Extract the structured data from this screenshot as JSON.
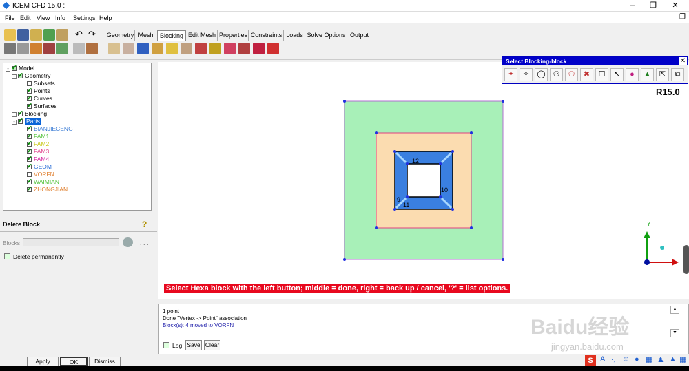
{
  "app": {
    "title": "ICEM CFD 15.0 :",
    "version_badge": "R15.0"
  },
  "menu": [
    "File",
    "Edit",
    "View",
    "Info",
    "Settings",
    "Help"
  ],
  "tabs": [
    {
      "label": "Geometry",
      "active": false
    },
    {
      "label": "Mesh",
      "active": false
    },
    {
      "label": "Blocking",
      "active": true
    },
    {
      "label": "Edit Mesh",
      "active": false
    },
    {
      "label": "Properties",
      "active": false
    },
    {
      "label": "Constraints",
      "active": false
    },
    {
      "label": "Loads",
      "active": false
    },
    {
      "label": "Solve Options",
      "active": false
    },
    {
      "label": "Output",
      "active": false
    }
  ],
  "tree": {
    "model": "Model",
    "geometry": "Geometry",
    "geo_items": [
      "Subsets",
      "Points",
      "Curves",
      "Surfaces"
    ],
    "blocking": "Blocking",
    "parts": "Parts",
    "part_items": [
      {
        "name": "BIANJIECENG",
        "color": "#3a7bd5",
        "checked": true
      },
      {
        "name": "FAM1",
        "color": "#52c23a",
        "checked": true
      },
      {
        "name": "FAM2",
        "color": "#c8c814",
        "checked": true
      },
      {
        "name": "FAM3",
        "color": "#e0408a",
        "checked": true
      },
      {
        "name": "FAM4",
        "color": "#d4209c",
        "checked": true
      },
      {
        "name": "GEOM",
        "color": "#2a6ed6",
        "checked": true
      },
      {
        "name": "VORFN",
        "color": "#e08030",
        "checked": false
      },
      {
        "name": "WAIMIAN",
        "color": "#52c23a",
        "checked": true
      },
      {
        "name": "ZHONGJIAN",
        "color": "#e08030",
        "checked": true
      }
    ]
  },
  "panel": {
    "title": "Delete Block",
    "blocks_label": "Blocks",
    "delete_permanently": "Delete permanently",
    "buttons": [
      "Apply",
      "OK",
      "Dismiss"
    ],
    "dots": ". . ."
  },
  "dialog": {
    "title": "Select Blocking-block"
  },
  "status_message": "Select Hexa block with the left button; middle = done, right = back up / cancel, '?' = list options.",
  "log": {
    "lines": [
      {
        "text": "1 point",
        "color": "#000"
      },
      {
        "text": "Done \"Vertex -> Point\" association",
        "color": "#000"
      },
      {
        "text": "Block(s): 4 moved to VORFN",
        "color": "#1a1aa8"
      }
    ],
    "log_label": "Log",
    "save": "Save",
    "clear": "Clear"
  },
  "viewport": {
    "block_labels": [
      "12",
      "10",
      "9",
      "11"
    ],
    "axis_y": "Y",
    "colors": {
      "outer": "#a8f0b8",
      "middle": "#fbdcb0",
      "inner": "#3a7fe0",
      "core": "#ffffff",
      "vertex": "#2030e0"
    }
  },
  "watermark": {
    "brand": "Baidu经验",
    "url": "jingyan.baidu.com"
  }
}
